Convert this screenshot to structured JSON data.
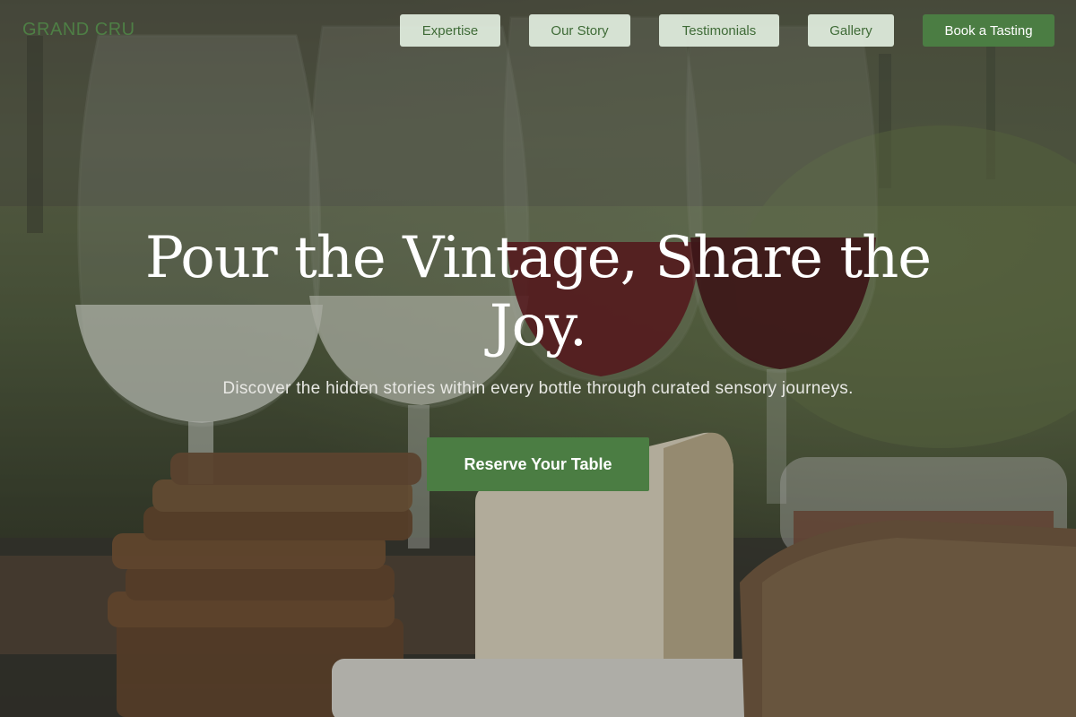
{
  "brand": {
    "logo": "GRAND CRU"
  },
  "nav": {
    "items": [
      {
        "label": "Expertise"
      },
      {
        "label": "Our Story"
      },
      {
        "label": "Testimonials"
      },
      {
        "label": "Gallery"
      }
    ],
    "cta_label": "Book a Tasting"
  },
  "hero": {
    "headline": "Pour the Vintage, Share the Joy.",
    "subheadline": "Discover the hidden stories within every bottle through curated sensory journeys.",
    "button_label": "Reserve Your Table"
  },
  "colors": {
    "accent_green": "#4b7d43",
    "nav_button_bg": "#e2eee0",
    "logo_green": "#4e7f45"
  }
}
